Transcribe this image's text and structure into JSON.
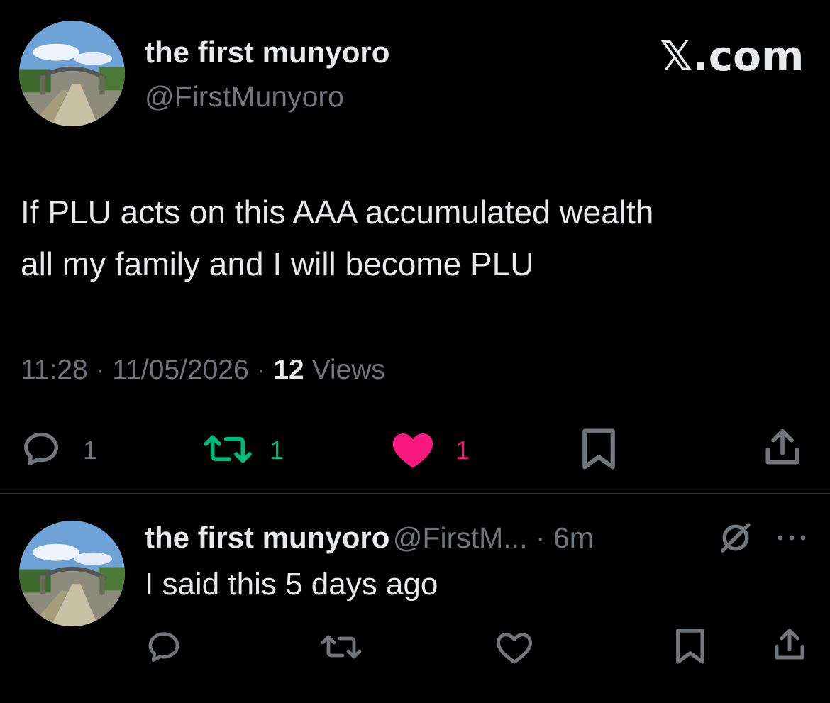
{
  "brand": {
    "logo_text": "𝕏.com"
  },
  "main_tweet": {
    "author_name": "the first munyoro",
    "author_handle": "@FirstMunyoro",
    "text_line1": "If PLU acts on this AAA accumulated wealth",
    "text_line2": "all my family and I will become PLU",
    "time": "11:28",
    "date": "11/05/2026",
    "views_count": "12",
    "views_label": "Views",
    "replies": "1",
    "retweets": "1",
    "likes": "1"
  },
  "reply_tweet": {
    "author_name": "the first munyoro",
    "author_handle": "@FirstM...",
    "time_ago": "6m",
    "text": "I said this 5 days ago"
  },
  "colors": {
    "background": "#000000",
    "text": "#e7e9ea",
    "muted": "#71767b",
    "retweet": "#00ba7c",
    "like": "#f91880"
  },
  "icons": [
    "reply-icon",
    "retweet-icon",
    "like-icon",
    "bookmark-icon",
    "share-icon",
    "grok-icon",
    "more-icon"
  ]
}
